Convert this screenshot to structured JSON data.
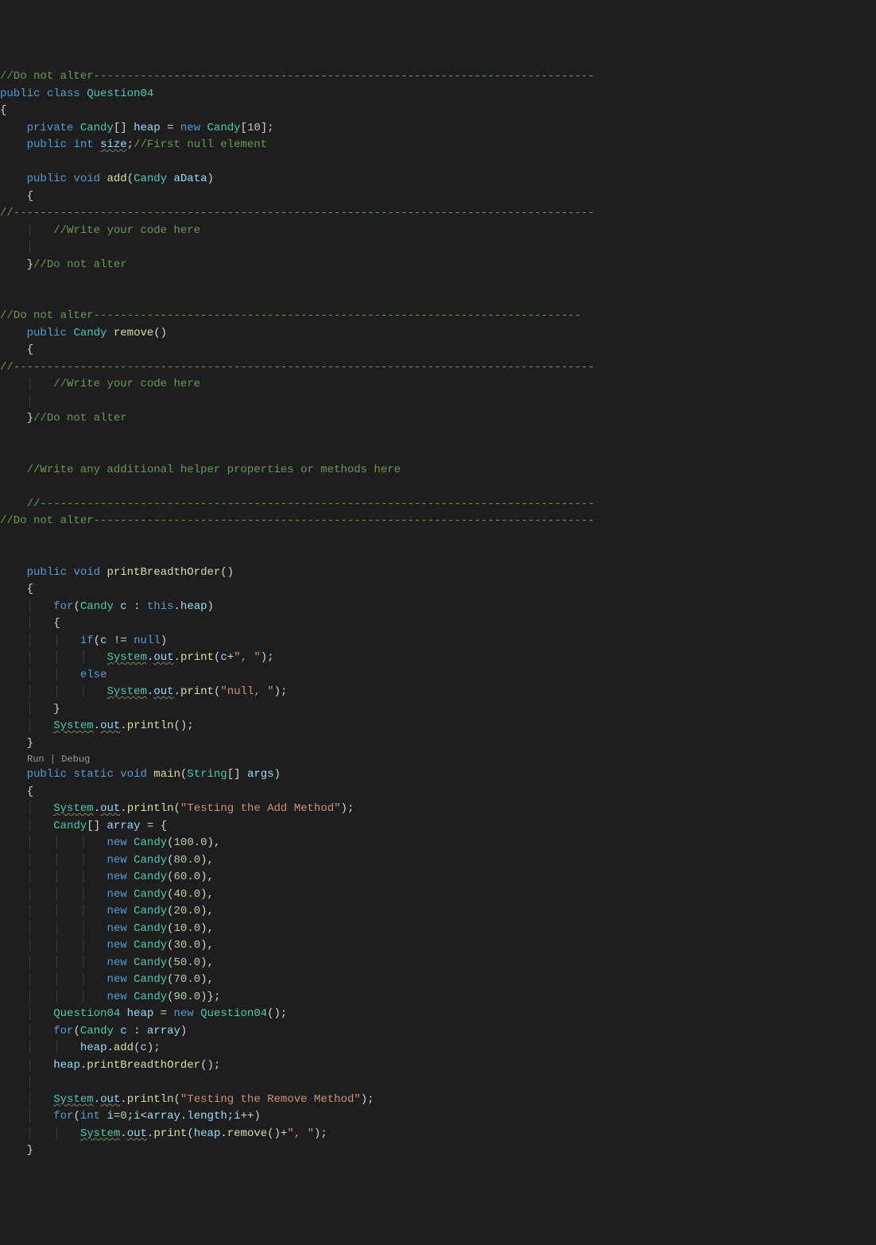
{
  "codelens_run": "Run",
  "codelens_sep": " | ",
  "codelens_debug": "Debug",
  "kw": {
    "public": "public",
    "class": "class",
    "private": "private",
    "new": "new",
    "void": "void",
    "static": "static",
    "int": "int",
    "for": "for",
    "if": "if",
    "else": "else",
    "this": "this",
    "null": "null"
  },
  "ty": {
    "Candy": "Candy",
    "Question04": "Question04",
    "String": "String",
    "System": "System"
  },
  "id": {
    "heap": "heap",
    "size": "size",
    "aData": "aData",
    "c": "c",
    "out": "out",
    "array": "array",
    "args": "args",
    "i": "i",
    "length": "length"
  },
  "mth": {
    "add": "add",
    "remove": "remove",
    "printBreadthOrder": "printBreadthOrder",
    "main": "main",
    "print": "print",
    "println": "println"
  },
  "num": {
    "ten": "10",
    "zero": "0",
    "hundred": "100.0",
    "eighty": "80.0",
    "sixty": "60.0",
    "forty": "40.0",
    "twenty": "20.0",
    "tenf": "10.0",
    "thirty": "30.0",
    "fifty": "50.0",
    "seventy": "70.0",
    "ninety": "90.0"
  },
  "str": {
    "comma": "\", \"",
    "nullc": "\"null, \"",
    "testAdd": "\"Testing the Add Method\"",
    "testRem": "\"Testing the Remove Method\""
  },
  "cm": {
    "dna": "//Do not alter",
    "first": "//First null element",
    "wyc": "//Write your code here",
    "wah": "//Write any additional helper properties or methods here",
    "dashSeg": "//",
    "line1": "//Do not alter---------------------------------------------------------------------------",
    "line2": "//---------------------------------------------------------------------------------------",
    "line3": "//Do not alter----------------------------------------------------------------------------",
    "tail1": "-------------------------------------------------------------------------",
    "tail2": "---------------------------------------------------------------------------",
    "tail3": "-----------------------------------------------------------------------------------"
  }
}
